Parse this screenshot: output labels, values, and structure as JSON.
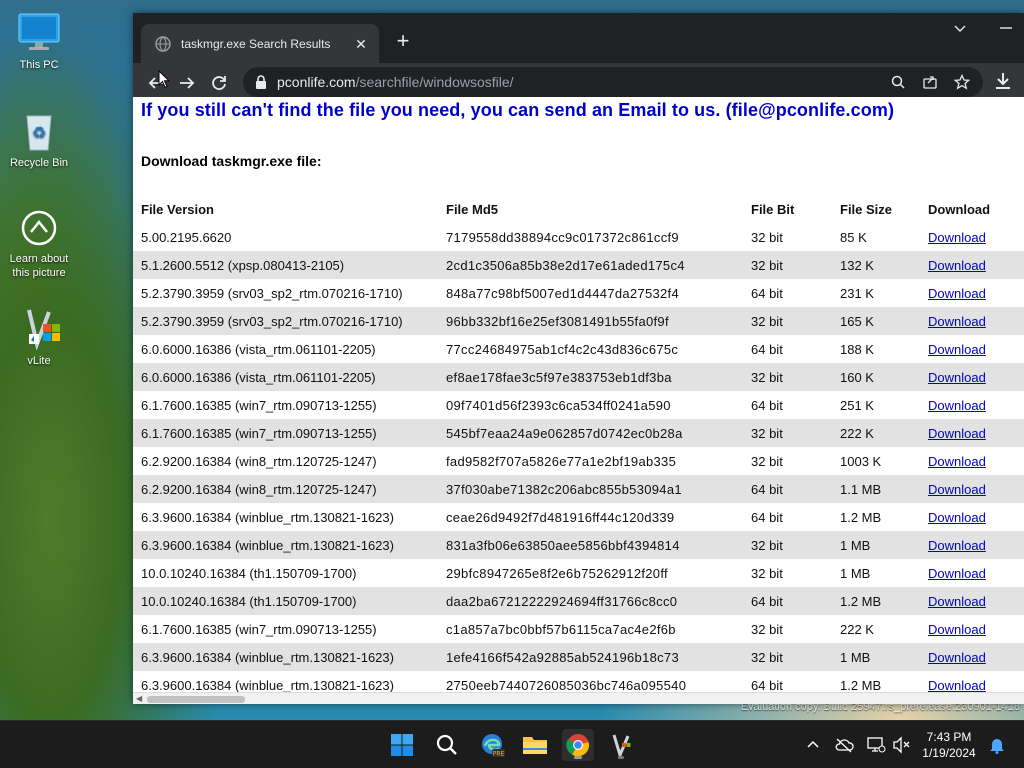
{
  "desktop": {
    "icons": [
      {
        "label": "This PC",
        "icon": "monitor-icon"
      },
      {
        "label": "Recycle Bin",
        "icon": "recycle-bin-icon"
      },
      {
        "label": "Learn about this picture",
        "icon": "info-camera-icon"
      },
      {
        "label": "vLite",
        "icon": "vlite-app-icon"
      }
    ],
    "watermark": "Evaluation copy. Build 25947.rs_prerelease.230901-1418"
  },
  "browser": {
    "tab_title": "taskmgr.exe Search Results",
    "url_host": "pconlife.com",
    "url_path": "/searchfile/windowsosfile/",
    "window_controls": {
      "dropdown": "⌄",
      "minimize": "—"
    }
  },
  "page": {
    "notice": "If you still can't find the file you need, you can send an Email to us. (file@pconlife.com)",
    "download_heading": "Download taskmgr.exe file:",
    "columns": [
      "File Version",
      "File Md5",
      "File Bit",
      "File Size",
      "Download"
    ],
    "rows": [
      {
        "version": "5.00.2195.6620",
        "md5": "7179558dd38894cc9c017372c861ccf9",
        "bit": "32 bit",
        "size": "85 K",
        "link": "Download"
      },
      {
        "version": "5.1.2600.5512 (xpsp.080413-2105)",
        "md5": "2cd1c3506a85b38e2d17e61aded175c4",
        "bit": "32 bit",
        "size": "132 K",
        "link": "Download"
      },
      {
        "version": "5.2.3790.3959 (srv03_sp2_rtm.070216-1710)",
        "md5": "848a77c98bf5007ed1d4447da27532f4",
        "bit": "64 bit",
        "size": "231 K",
        "link": "Download"
      },
      {
        "version": "5.2.3790.3959 (srv03_sp2_rtm.070216-1710)",
        "md5": "96bb332bf16e25ef3081491b55fa0f9f",
        "bit": "32 bit",
        "size": "165 K",
        "link": "Download"
      },
      {
        "version": "6.0.6000.16386 (vista_rtm.061101-2205)",
        "md5": "77cc24684975ab1cf4c2c43d836c675c",
        "bit": "64 bit",
        "size": "188 K",
        "link": "Download"
      },
      {
        "version": "6.0.6000.16386 (vista_rtm.061101-2205)",
        "md5": "ef8ae178fae3c5f97e383753eb1df3ba",
        "bit": "32 bit",
        "size": "160 K",
        "link": "Download"
      },
      {
        "version": "6.1.7600.16385 (win7_rtm.090713-1255)",
        "md5": "09f7401d56f2393c6ca534ff0241a590",
        "bit": "64 bit",
        "size": "251 K",
        "link": "Download"
      },
      {
        "version": "6.1.7600.16385 (win7_rtm.090713-1255)",
        "md5": "545bf7eaa24a9e062857d0742ec0b28a",
        "bit": "32 bit",
        "size": "222 K",
        "link": "Download"
      },
      {
        "version": "6.2.9200.16384 (win8_rtm.120725-1247)",
        "md5": "fad9582f707a5826e77a1e2bf19ab335",
        "bit": "32 bit",
        "size": "1003 K",
        "link": "Download"
      },
      {
        "version": "6.2.9200.16384 (win8_rtm.120725-1247)",
        "md5": "37f030abe71382c206abc855b53094a1",
        "bit": "64 bit",
        "size": "1.1 MB",
        "link": "Download"
      },
      {
        "version": "6.3.9600.16384 (winblue_rtm.130821-1623)",
        "md5": "ceae26d9492f7d481916ff44c120d339",
        "bit": "64 bit",
        "size": "1.2 MB",
        "link": "Download"
      },
      {
        "version": "6.3.9600.16384 (winblue_rtm.130821-1623)",
        "md5": "831a3fb06e63850aee5856bbf4394814",
        "bit": "32 bit",
        "size": "1 MB",
        "link": "Download"
      },
      {
        "version": "10.0.10240.16384 (th1.150709-1700)",
        "md5": "29bfc8947265e8f2e6b75262912f20ff",
        "bit": "32 bit",
        "size": "1 MB",
        "link": "Download"
      },
      {
        "version": "10.0.10240.16384 (th1.150709-1700)",
        "md5": "daa2ba67212222924694ff31766c8cc0",
        "bit": "64 bit",
        "size": "1.2 MB",
        "link": "Download"
      },
      {
        "version": "6.1.7600.16385 (win7_rtm.090713-1255)",
        "md5": "c1a857a7bc0bbf57b6115ca7ac4e2f6b",
        "bit": "32 bit",
        "size": "222 K",
        "link": "Download"
      },
      {
        "version": "6.3.9600.16384 (winblue_rtm.130821-1623)",
        "md5": "1efe4166f542a92885ab524196b18c73",
        "bit": "32 bit",
        "size": "1 MB",
        "link": "Download"
      },
      {
        "version": "6.3.9600.16384 (winblue_rtm.130821-1623)",
        "md5": "2750eeb7440726085036bc746a095540",
        "bit": "64 bit",
        "size": "1.2 MB",
        "link": "Download"
      }
    ]
  },
  "taskbar": {
    "apps": [
      "start-icon",
      "search-icon",
      "edge-beta-icon",
      "file-explorer-icon",
      "chrome-icon",
      "vlite-icon"
    ],
    "tray": [
      "chevron-up-icon",
      "cloud-offline-icon",
      "network-icon",
      "volume-muted-icon"
    ],
    "time": "7:43 PM",
    "date": "1/19/2024"
  },
  "colors": {
    "link": "#0000cc",
    "row_alt": "#e2e2e2",
    "chrome_dark": "#202124",
    "chrome_toolbar": "#35363a",
    "taskbar": "#1c1c1c"
  }
}
